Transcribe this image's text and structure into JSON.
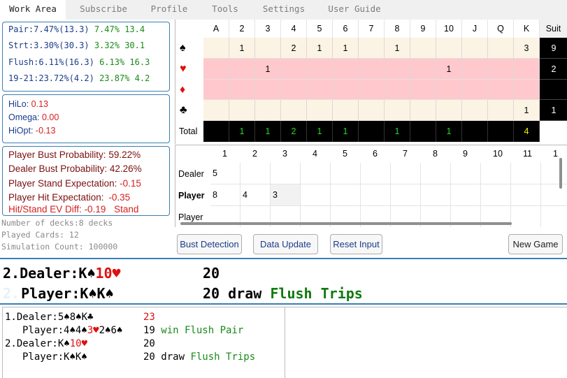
{
  "tabs": [
    "Work Area",
    "Subscribe",
    "Profile",
    "Tools",
    "Settings",
    "User Guide"
  ],
  "odds": [
    {
      "label": "Pair:7.47%(13.3)",
      "a": "7.47%",
      "b": "13.4"
    },
    {
      "label": "Strt:3.30%(30.3)",
      "a": "3.32%",
      "b": "30.1"
    },
    {
      "label": "Flush:6.11%(16.3)",
      "a": "6.13%",
      "b": "16.3"
    },
    {
      "label": "19-21:23.72%(4.2)",
      "a": "23.87%",
      "b": "4.2"
    }
  ],
  "counts": [
    {
      "label": "HiLo:",
      "value": "0.13"
    },
    {
      "label": "Omega:",
      "value": "0.00"
    },
    {
      "label": "HiOpt:",
      "value": "-0.13"
    }
  ],
  "ev": {
    "player_bust": {
      "label": "Player Bust Probability:",
      "value": "59.22%"
    },
    "dealer_bust": {
      "label": "Dealer Bust Probability:",
      "value": "42.26%"
    },
    "stand_exp": {
      "label": "Player Stand Expectation:",
      "value": "-0.15"
    },
    "hit_exp": {
      "label": "Player Hit Expectation:",
      "value": "-0.35"
    },
    "diff": {
      "label": "Hit/Stand EV Diff:",
      "value": "-0.19",
      "advice": "Stand"
    }
  },
  "deck_info": {
    "decks": "Number of decks:8 decks",
    "played": "Played Cards: 12",
    "sims": "Simulation Count: 100000"
  },
  "card_table": {
    "headers": [
      "A",
      "2",
      "3",
      "4",
      "5",
      "6",
      "7",
      "8",
      "9",
      "10",
      "J",
      "Q",
      "K",
      "Suit"
    ],
    "rows": [
      {
        "suit": "♠",
        "suit_color": "#000000",
        "bg": "#fbf3e4",
        "cells": [
          "",
          "1",
          "",
          "2",
          "1",
          "1",
          "",
          "1",
          "",
          "",
          "",
          "",
          "3"
        ],
        "total": "9"
      },
      {
        "suit": "♥",
        "suit_color": "#e01010",
        "bg": "#ffc8cd",
        "cells": [
          "",
          "",
          "1",
          "",
          "",
          "",
          "",
          "",
          "",
          "1",
          "",
          "",
          ""
        ],
        "total": "2"
      },
      {
        "suit": "♦",
        "suit_color": "#e01010",
        "bg": "#ffc8cd",
        "cells": [
          "",
          "",
          "",
          "",
          "",
          "",
          "",
          "",
          "",
          "",
          "",
          "",
          ""
        ],
        "total": ""
      },
      {
        "suit": "♣",
        "suit_color": "#000000",
        "bg": "#fbf3e4",
        "cells": [
          "",
          "",
          "",
          "",
          "",
          "",
          "",
          "",
          "",
          "",
          "",
          "",
          "1"
        ],
        "total": "1"
      }
    ],
    "total_label": "Total",
    "totals": [
      "",
      "1",
      "1",
      "2",
      "1",
      "1",
      "",
      "1",
      "",
      "1",
      "",
      "",
      "4"
    ],
    "total_colors": [
      "#2bd62b",
      "#2bd62b",
      "#2bd62b",
      "#2bd62b",
      "#2bd62b",
      "#2bd62b",
      "#2bd62b",
      "#2bd62b",
      "#2bd62b",
      "#2bd62b",
      "#2bd62b",
      "#2bd62b",
      "#f0f000"
    ]
  },
  "pd_table": {
    "headers": [
      "1",
      "2",
      "3",
      "4",
      "5",
      "6",
      "7",
      "8",
      "9",
      "10",
      "11",
      "1"
    ],
    "rows": [
      {
        "label": "Dealer",
        "bold": false,
        "cells": [
          "5",
          "",
          "",
          "",
          "",
          "",
          "",
          "",
          "",
          "",
          "",
          ""
        ]
      },
      {
        "label": "Player",
        "bold": true,
        "cells": [
          "8",
          "4",
          "3",
          "",
          "",
          "",
          "",
          "",
          "",
          "",
          "",
          ""
        ]
      },
      {
        "label": "Player",
        "bold": false,
        "cells": [
          "",
          "",
          "",
          "",
          "",
          "",
          "",
          "",
          "",
          "",
          "",
          ""
        ]
      }
    ]
  },
  "buttons": {
    "bust": "Bust Detection",
    "update": "Data Update",
    "reset": "Reset Input",
    "new_game": "New Game"
  },
  "result": {
    "dealer": {
      "prefix": "2.Dealer:",
      "cards": [
        {
          "t": "K♠",
          "c": "#000000"
        },
        {
          "t": "10♥",
          "c": "#e01010"
        }
      ],
      "score": "20",
      "outcome": "",
      "bonus": ""
    },
    "player": {
      "prefix": "Player:",
      "cards": [
        {
          "t": "K♠",
          "c": "#000000"
        },
        {
          "t": "K♠",
          "c": "#000000"
        }
      ],
      "score": "20",
      "outcome": "draw",
      "bonus": "Flush Trips"
    },
    "ghost_index": "2."
  },
  "history": [
    {
      "indent": false,
      "prefix": "1.Dealer:",
      "cards": [
        {
          "t": "5♠",
          "c": "#000000"
        },
        {
          "t": "8♠",
          "c": "#000000"
        },
        {
          "t": "K♣",
          "c": "#000000"
        }
      ],
      "score": "23",
      "score_color": "#e01010",
      "outcome": "",
      "bonus": ""
    },
    {
      "indent": true,
      "prefix": "Player:",
      "cards": [
        {
          "t": "4♠",
          "c": "#000000"
        },
        {
          "t": "4♠",
          "c": "#000000"
        },
        {
          "t": "3♥",
          "c": "#e01010"
        },
        {
          "t": "2♠",
          "c": "#000000"
        },
        {
          "t": "6♠",
          "c": "#000000"
        }
      ],
      "score": "19",
      "score_color": "#000000",
      "outcome": "win",
      "bonus": "Flush Pair"
    },
    {
      "indent": false,
      "prefix": "2.Dealer:",
      "cards": [
        {
          "t": "K♠",
          "c": "#000000"
        },
        {
          "t": "10♥",
          "c": "#e01010"
        }
      ],
      "score": "20",
      "score_color": "#000000",
      "outcome": "",
      "bonus": ""
    },
    {
      "indent": true,
      "prefix": "Player:",
      "cards": [
        {
          "t": "K♠",
          "c": "#000000"
        },
        {
          "t": "K♠",
          "c": "#000000"
        }
      ],
      "score": "20",
      "score_color": "#000000",
      "outcome": "draw",
      "bonus": "Flush Trips"
    }
  ],
  "colors": {
    "accent": "#3a7fb5",
    "win_green": "#1a8a1a",
    "red": "#e01010",
    "total_bg": "#000000"
  }
}
